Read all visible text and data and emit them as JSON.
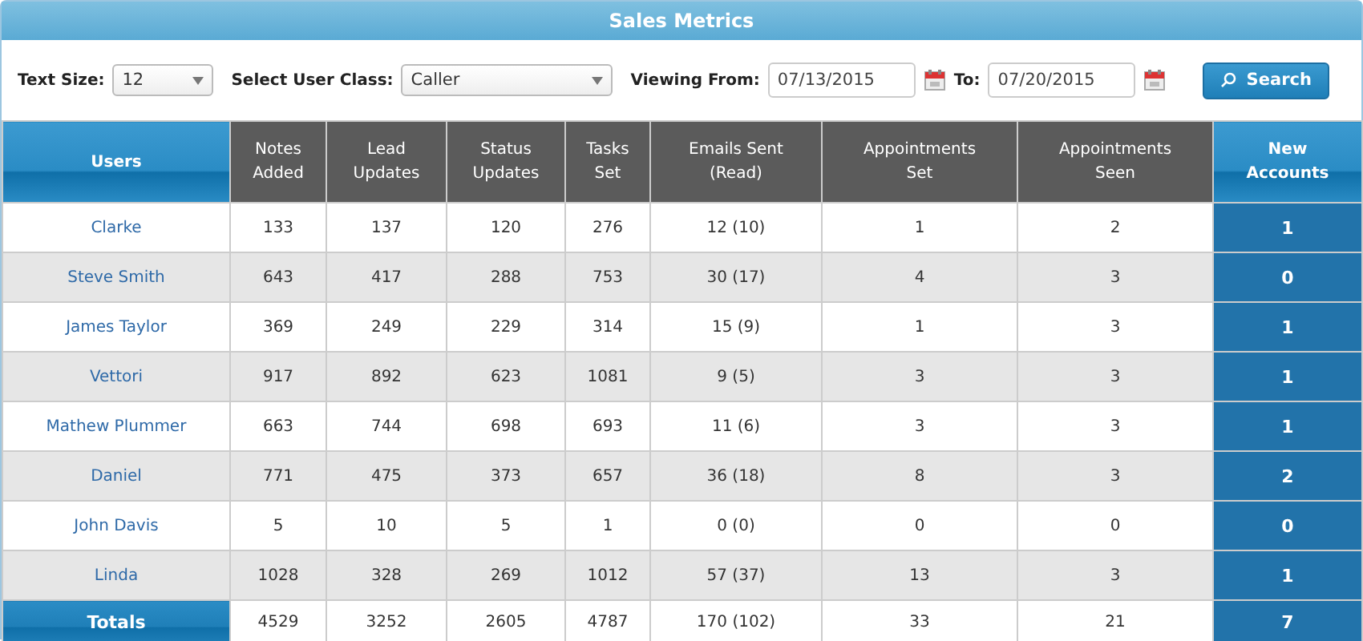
{
  "window": {
    "title": "Sales Metrics"
  },
  "filters": {
    "text_size_label": "Text Size:",
    "text_size": "12",
    "user_class_label": "Select User Class:",
    "user_class": "Caller",
    "from_label": "Viewing From:",
    "from": "07/13/2015",
    "to_label": "To:",
    "to": "07/20/2015",
    "search_button": "Search"
  },
  "table": {
    "columns": [
      {
        "label": "Users",
        "kind": "accent"
      },
      {
        "label": "Notes Added",
        "kind": "plain"
      },
      {
        "label": "Lead Updates",
        "kind": "plain"
      },
      {
        "label": "Status Updates",
        "kind": "plain"
      },
      {
        "label": "Tasks Set",
        "kind": "plain"
      },
      {
        "label": "Emails Sent (Read)",
        "kind": "plain"
      },
      {
        "label": "Appointments Set",
        "kind": "plain"
      },
      {
        "label": "Appointments Seen",
        "kind": "plain"
      },
      {
        "label": "New Accounts",
        "kind": "accent"
      }
    ],
    "rows": [
      {
        "cells": [
          "Clarke",
          "133",
          "137",
          "120",
          "276",
          "12 (10)",
          "1",
          "2",
          "1"
        ]
      },
      {
        "cells": [
          "Steve Smith",
          "643",
          "417",
          "288",
          "753",
          "30 (17)",
          "4",
          "3",
          "0"
        ]
      },
      {
        "cells": [
          "James Taylor",
          "369",
          "249",
          "229",
          "314",
          "15 (9)",
          "1",
          "3",
          "1"
        ]
      },
      {
        "cells": [
          "Vettori",
          "917",
          "892",
          "623",
          "1081",
          "9 (5)",
          "3",
          "3",
          "1"
        ]
      },
      {
        "cells": [
          "Mathew Plummer",
          "663",
          "744",
          "698",
          "693",
          "11 (6)",
          "3",
          "3",
          "1"
        ]
      },
      {
        "cells": [
          "Daniel",
          "771",
          "475",
          "373",
          "657",
          "36 (18)",
          "8",
          "3",
          "2"
        ]
      },
      {
        "cells": [
          "John Davis",
          "5",
          "10",
          "5",
          "1",
          "0 (0)",
          "0",
          "0",
          "0"
        ]
      },
      {
        "cells": [
          "Linda",
          "1028",
          "328",
          "269",
          "1012",
          "57 (37)",
          "13",
          "3",
          "1"
        ]
      }
    ],
    "totals": {
      "cells": [
        "Totals",
        "4529",
        "3252",
        "2605",
        "4787",
        "170 (102)",
        "33",
        "21",
        "7"
      ]
    }
  }
}
